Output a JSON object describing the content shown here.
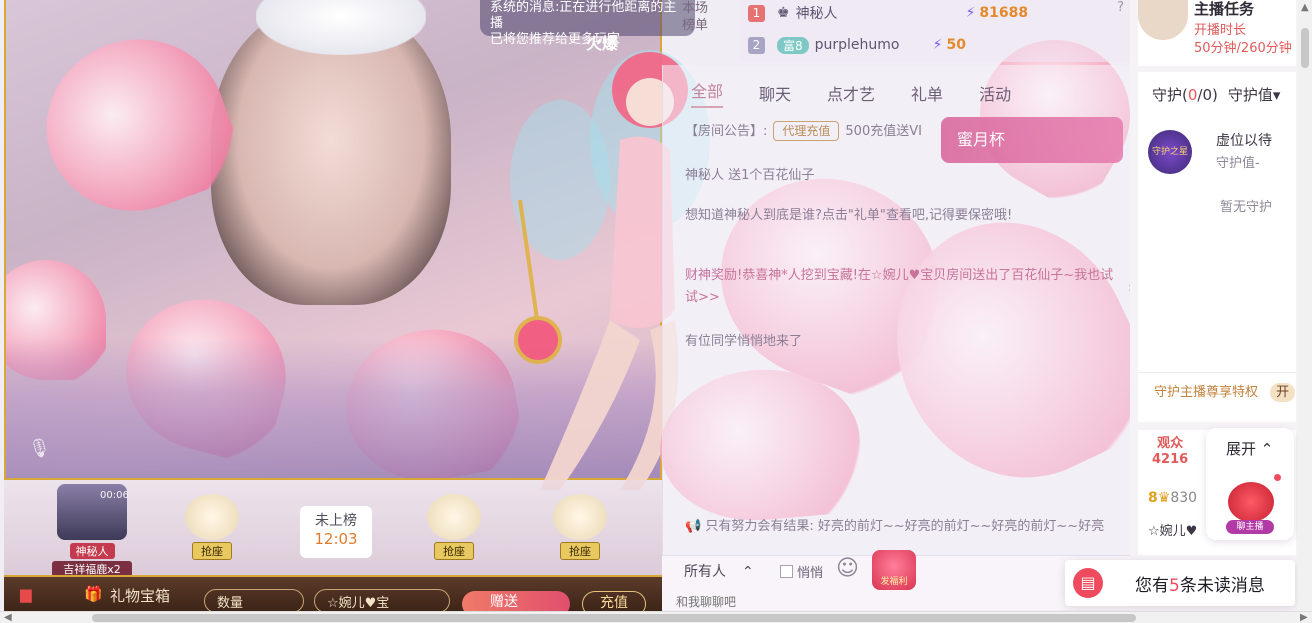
{
  "top_notice": {
    "line1": "系统的消息:正在进行他距离的主播",
    "line2": "已将您推荐给更多玩家",
    "fire": "火爆"
  },
  "rank": {
    "button_line1": "本场",
    "button_line2": "榜单",
    "rows": [
      {
        "num": "1",
        "name": "神秘人",
        "score": "81688"
      },
      {
        "num": "2",
        "level": "富8",
        "name": "purplehumo",
        "score": "50"
      }
    ]
  },
  "chat": {
    "tabs": [
      "全部",
      "聊天",
      "点才艺",
      "礼单",
      "活动"
    ],
    "notice_prefix": "【房间公告】:",
    "notice_chip": "代理充值",
    "notice_text": "500充值送VI",
    "honey_label": "蜜月杯",
    "messages": [
      "神秘人 送1个百花仙子",
      "想知道神秘人到底是谁?点击\"礼单\"查看吧,记得要保密哦!",
      "财神奖励!恭喜神*人挖到宝藏!在☆婉儿♥宝贝房间送出了百花仙子~我也试试>>",
      "有位同学悄悄地来了"
    ],
    "bottom_message": "只有努力会有结果: 好亮的前灯~~好亮的前灯~~好亮的前灯~~好亮"
  },
  "input_bar": {
    "target": "所有人",
    "whisper": "悄悄",
    "lucky_label": "发福利",
    "placeholder": "和我聊聊吧"
  },
  "seats": {
    "host_time": "00:06",
    "host_name": "神秘人",
    "host_gift": "吉祥福鹿x2",
    "grab_label": "抢座",
    "unlisted_label": "未上榜",
    "unlisted_time": "12:03"
  },
  "toolbar": {
    "gift_box": "礼物宝箱",
    "quantity": "数量",
    "recipient": "☆婉儿♥宝",
    "send": "赠送",
    "recharge": "充值"
  },
  "task": {
    "title": "主播任务",
    "line1": "开播时长",
    "line2": "50分钟/260分钟"
  },
  "guard": {
    "tab1_prefix": "守护(",
    "tab1_count": "0",
    "tab1_suffix": "/0)",
    "tab2": "守护值▾",
    "badge_text": "守护之星",
    "vacant": "虚位以待",
    "vacant_val": "守护值-",
    "empty": "暂无守护",
    "privilege": "守护主播尊享特权",
    "open_btn": "开"
  },
  "viewers": {
    "label": "观众",
    "count": "4216",
    "user1_level": "8",
    "user1": "830",
    "user2": "☆婉儿♥"
  },
  "expand": {
    "label": "展开",
    "tag": "聊主播"
  },
  "unread": {
    "prefix": "您有",
    "count": "5",
    "suffix": "条未读消息"
  },
  "colors": {
    "accent": "#d9a3b6",
    "alert": "#ef4b5f",
    "gold": "#d7a836"
  }
}
